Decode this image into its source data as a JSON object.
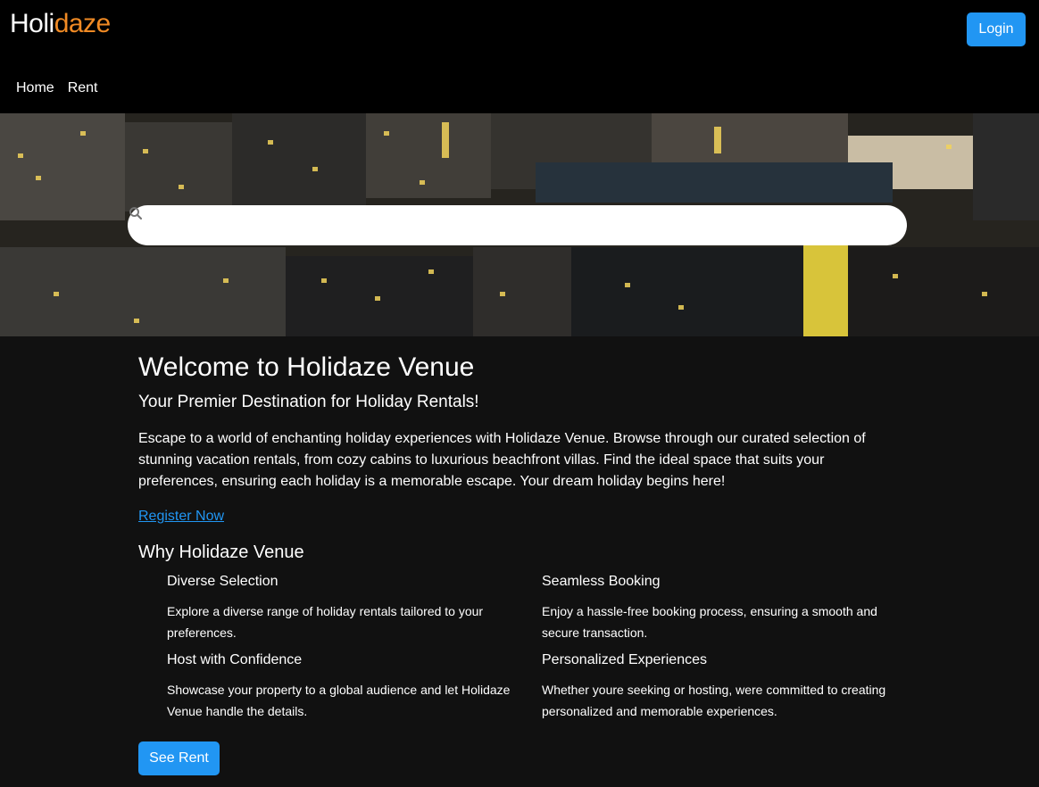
{
  "header": {
    "logo_part1": "Holi",
    "logo_part2": "daze",
    "login_label": "Login",
    "nav": [
      "Home",
      "Rent"
    ]
  },
  "search": {
    "placeholder": "",
    "icon": "search-icon"
  },
  "main": {
    "title": "Welcome to Holidaze Venue",
    "subtitle": "Your Premier Destination for Holiday Rentals!",
    "intro": "Escape to a world of enchanting holiday experiences with Holidaze Venue. Browse through our curated selection of stunning vacation rentals, from cozy cabins to luxurious beachfront villas. Find the ideal space that suits your preferences, ensuring each holiday is a memorable escape. Your dream holiday begins here!",
    "register_link": "Register Now",
    "why_title": "Why Holidaze Venue",
    "features": [
      {
        "title": "Diverse Selection",
        "desc": "Explore a diverse range of holiday rentals tailored to your preferences."
      },
      {
        "title": "Seamless Booking",
        "desc": "Enjoy a hassle-free booking process, ensuring a smooth and secure transaction."
      },
      {
        "title": "Host with Confidence",
        "desc": "Showcase your property to a global audience and let Holidaze Venue handle the details."
      },
      {
        "title": "Personalized Experiences",
        "desc": "Whether youre seeking or hosting, were committed to creating personalized and memorable experiences."
      }
    ],
    "see_rent_label": "See Rent"
  },
  "colors": {
    "accent_blue": "#2196f3",
    "logo_orange": "#f08a24",
    "header_bg": "#000000",
    "body_bg": "#111111"
  }
}
